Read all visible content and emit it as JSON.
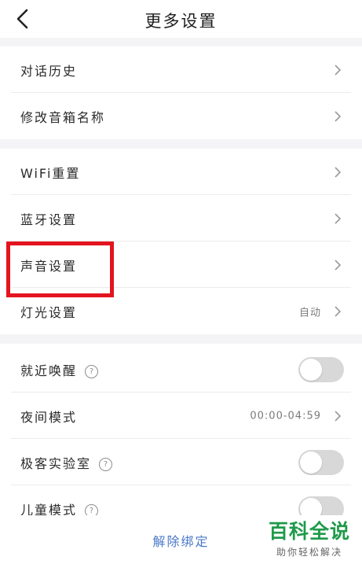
{
  "header": {
    "title": "更多设置",
    "back_icon": "chevron-left-icon"
  },
  "groups": [
    {
      "rows": [
        {
          "label": "对话历史"
        },
        {
          "label": "修改音箱名称"
        }
      ]
    },
    {
      "rows": [
        {
          "label": "WiFi重置"
        },
        {
          "label": "蓝牙设置"
        },
        {
          "label": "声音设置"
        },
        {
          "label": "灯光设置",
          "value": "自动"
        }
      ]
    },
    {
      "rows": [
        {
          "label": "就近唤醒",
          "help": "?",
          "toggle": "off"
        },
        {
          "label": "夜间模式",
          "value": "00:00-04:59"
        },
        {
          "label": "极客实验室",
          "help": "?",
          "toggle": "off"
        },
        {
          "label": "儿童模式",
          "help": "?",
          "toggle": "off"
        }
      ]
    }
  ],
  "footer": {
    "unbind_label": "解除绑定"
  },
  "watermark": {
    "title": "百科全说",
    "subtitle": "助你轻松解决"
  },
  "colors": {
    "link_blue": "#4a78c9",
    "highlight_red": "#e3141e",
    "toggle_off": "#d8d8d8",
    "watermark_green": "#1e9a4a"
  }
}
